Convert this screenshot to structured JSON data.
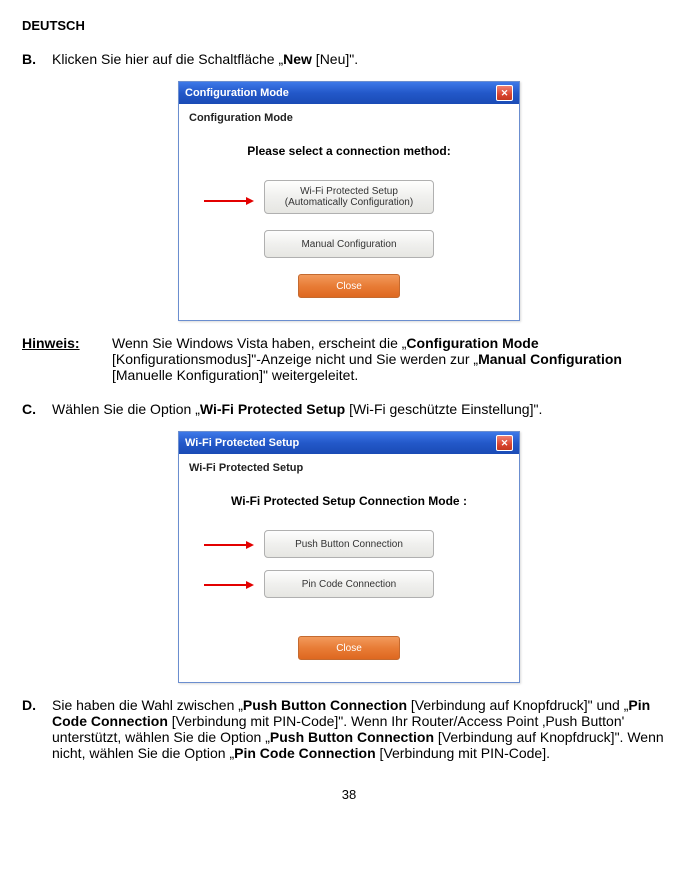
{
  "header": "DEUTSCH",
  "stepB": {
    "letter": "B.",
    "pre": "Klicken Sie hier auf die Schaltfläche „",
    "bold": "New",
    "post": " [Neu]\"."
  },
  "win1": {
    "title": "Configuration Mode",
    "section": "Configuration Mode",
    "msg": "Please select a connection method:",
    "btn1a": "Wi-Fi Protected Setup",
    "btn1b": "(Automatically Configuration)",
    "btn2": "Manual Configuration",
    "close": "Close"
  },
  "note": {
    "label": "Hinweis:",
    "t1": "Wenn Sie Windows Vista haben, erscheint die „",
    "b1": "Configuration Mode",
    "t2": " [Konfigurationsmodus]\"-Anzeige nicht und Sie werden zur „",
    "b2": "Manual Configuration",
    "t3": " [Manuelle Konfiguration]\" weitergeleitet."
  },
  "stepC": {
    "letter": "C.",
    "t1": "Wählen Sie die Option „",
    "b1": "Wi-Fi Protected Setup",
    "t2": " [Wi-Fi geschützte Einstellung]\"."
  },
  "win2": {
    "title": "Wi-Fi Protected Setup",
    "section": "Wi-Fi Protected Setup",
    "msg": "Wi-Fi Protected Setup Connection  Mode :",
    "btn1": "Push Button Connection",
    "btn2": "Pin Code Connection",
    "close": "Close"
  },
  "stepD": {
    "letter": "D.",
    "t1": "Sie haben die Wahl zwischen „",
    "b1": "Push Button Connection",
    "t2": " [Verbindung auf Knopfdruck]\" und „",
    "b2": "Pin Code Connection",
    "t3": " [Verbindung mit PIN-Code]\". Wenn Ihr Router/Access Point ‚Push Button' unterstützt, wählen Sie die Option „",
    "b3": "Push Button Connection",
    "t4": " [Verbindung auf Knopfdruck]\". Wenn nicht, wählen Sie die Option „",
    "b4": "Pin Code Connection",
    "t5": " [Verbindung mit PIN-Code]."
  },
  "page": "38"
}
